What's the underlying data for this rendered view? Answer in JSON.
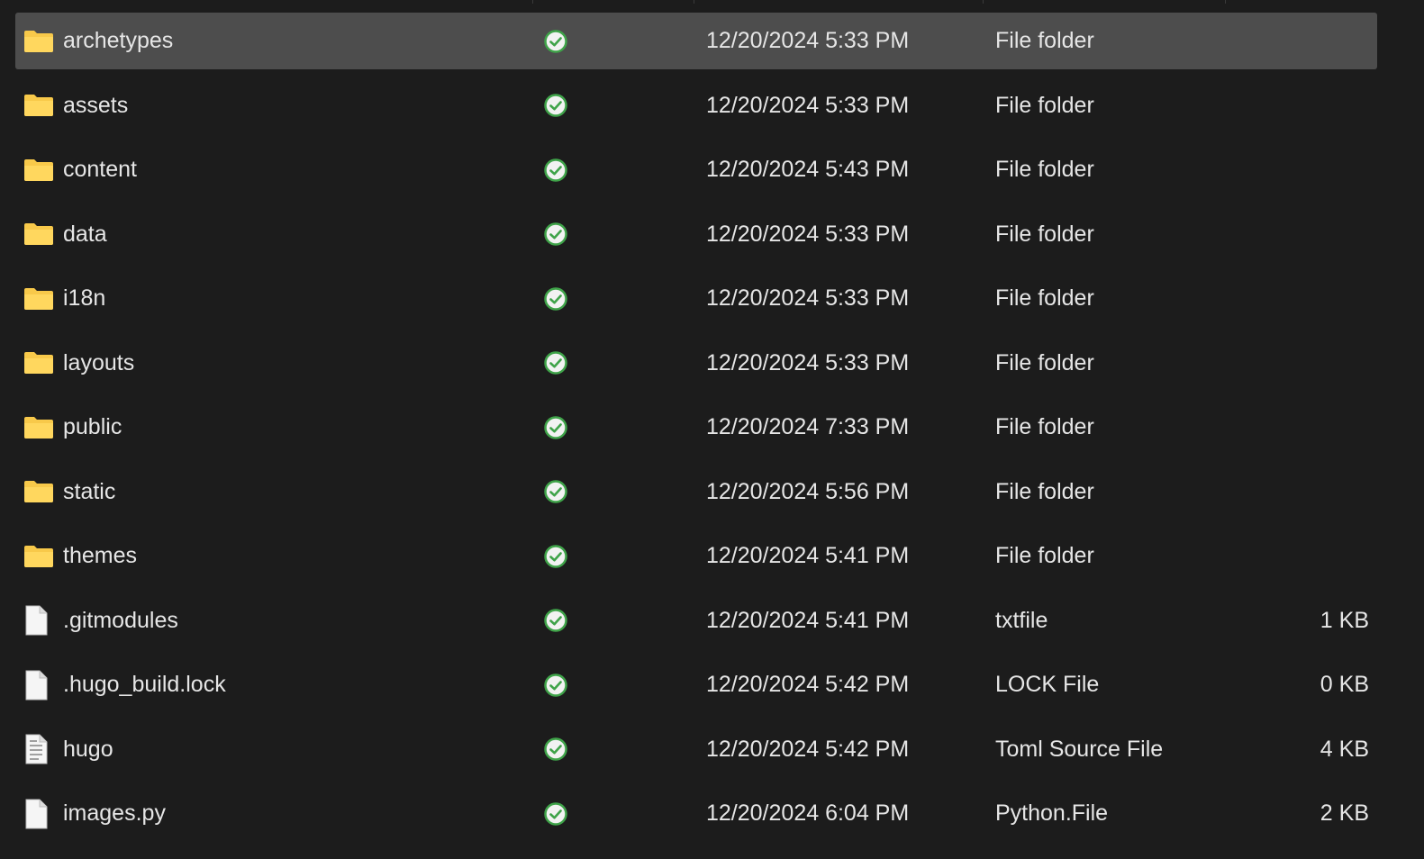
{
  "colors": {
    "background": "#1c1c1c",
    "selected_row": "#4d4d4d",
    "folder": "#f8c94a",
    "status_ok": "#3fa349",
    "text": "#e6e6e6"
  },
  "files": [
    {
      "name": "archetypes",
      "icon": "folder-icon",
      "status": "synced-check-icon",
      "date": "12/20/2024 5:33 PM",
      "type": "File folder",
      "size": "",
      "selected": true
    },
    {
      "name": "assets",
      "icon": "folder-icon",
      "status": "synced-check-icon",
      "date": "12/20/2024 5:33 PM",
      "type": "File folder",
      "size": ""
    },
    {
      "name": "content",
      "icon": "folder-icon",
      "status": "synced-check-icon",
      "date": "12/20/2024 5:43 PM",
      "type": "File folder",
      "size": ""
    },
    {
      "name": "data",
      "icon": "folder-icon",
      "status": "synced-check-icon",
      "date": "12/20/2024 5:33 PM",
      "type": "File folder",
      "size": ""
    },
    {
      "name": "i18n",
      "icon": "folder-icon",
      "status": "synced-check-icon",
      "date": "12/20/2024 5:33 PM",
      "type": "File folder",
      "size": ""
    },
    {
      "name": "layouts",
      "icon": "folder-icon",
      "status": "synced-check-icon",
      "date": "12/20/2024 5:33 PM",
      "type": "File folder",
      "size": ""
    },
    {
      "name": "public",
      "icon": "folder-icon",
      "status": "synced-check-icon",
      "date": "12/20/2024 7:33 PM",
      "type": "File folder",
      "size": ""
    },
    {
      "name": "static",
      "icon": "folder-icon",
      "status": "synced-check-icon",
      "date": "12/20/2024 5:56 PM",
      "type": "File folder",
      "size": ""
    },
    {
      "name": "themes",
      "icon": "folder-icon",
      "status": "synced-check-icon",
      "date": "12/20/2024 5:41 PM",
      "type": "File folder",
      "size": ""
    },
    {
      "name": ".gitmodules",
      "icon": "file-icon",
      "status": "synced-check-icon",
      "date": "12/20/2024 5:41 PM",
      "type": "txtfile",
      "size": "1 KB"
    },
    {
      "name": ".hugo_build.lock",
      "icon": "file-icon",
      "status": "synced-check-icon",
      "date": "12/20/2024 5:42 PM",
      "type": "LOCK File",
      "size": "0 KB"
    },
    {
      "name": "hugo",
      "icon": "text-file-icon",
      "status": "synced-check-icon",
      "date": "12/20/2024 5:42 PM",
      "type": "Toml Source File",
      "size": "4 KB"
    },
    {
      "name": "images.py",
      "icon": "file-icon",
      "status": "synced-check-icon",
      "date": "12/20/2024 6:04 PM",
      "type": "Python.File",
      "size": "2 KB"
    }
  ]
}
